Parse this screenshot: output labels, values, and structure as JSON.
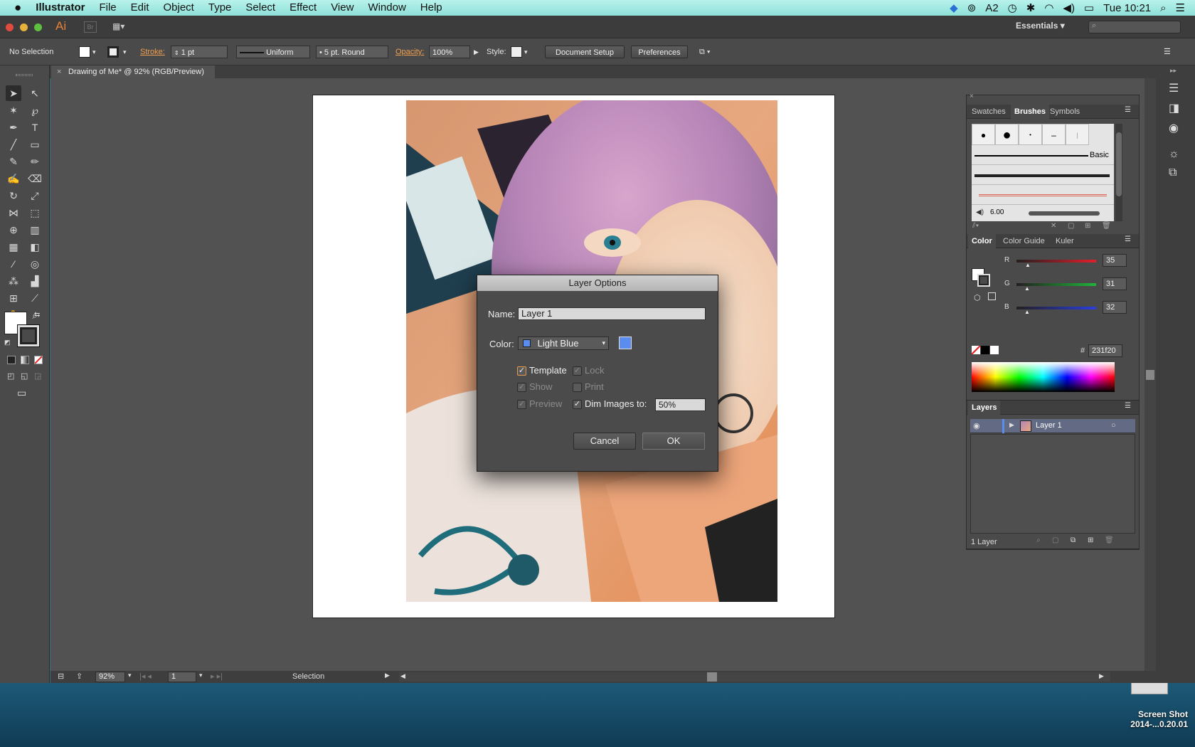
{
  "menubar": {
    "apple": "",
    "app_name": "Illustrator",
    "items": [
      "File",
      "Edit",
      "Object",
      "Type",
      "Select",
      "Effect",
      "View",
      "Window",
      "Help"
    ],
    "status": {
      "adobe_count": "2",
      "clock": "Tue 10:21"
    }
  },
  "appbar": {
    "logo": "Ai",
    "bridge": "Br",
    "workspace": "Essentials",
    "search_placeholder": ""
  },
  "control": {
    "selection": "No Selection",
    "stroke_label": "Stroke:",
    "stroke_weight": "1 pt",
    "profile": "Uniform",
    "brush": "5 pt. Round",
    "opacity_label": "Opacity:",
    "opacity": "100%",
    "style_label": "Style:",
    "doc_setup": "Document Setup",
    "preferences": "Preferences"
  },
  "document": {
    "tab_title": "Drawing of Me* @ 92% (RGB/Preview)",
    "close": "×"
  },
  "status": {
    "zoom": "92%",
    "artboard": "1",
    "tool": "Selection"
  },
  "brushes_panel": {
    "tabs": [
      "Swatches",
      "Brushes",
      "Symbols"
    ],
    "basic_label": "Basic",
    "brush_size": "6.00"
  },
  "color_panel": {
    "tabs": [
      "Color",
      "Color Guide",
      "Kuler"
    ],
    "r_label": "R",
    "g_label": "G",
    "b_label": "B",
    "r": "35",
    "g": "31",
    "b": "32",
    "hex_label": "#",
    "hex": "231f20"
  },
  "layers_panel": {
    "title": "Layers",
    "layer_name": "Layer 1",
    "footer": "1 Layer"
  },
  "dialog": {
    "title": "Layer Options",
    "name_label": "Name:",
    "name_value": "Layer 1",
    "color_label": "Color:",
    "color_value": "Light Blue",
    "swatch_color": "#5b8cf0",
    "template": "Template",
    "lock": "Lock",
    "show": "Show",
    "print": "Print",
    "preview": "Preview",
    "dim": "Dim Images to:",
    "dim_value": "50%",
    "cancel": "Cancel",
    "ok": "OK"
  },
  "desktop": {
    "file_label_1": "Screen Shot",
    "file_label_2": "2014-...0.20.01"
  }
}
